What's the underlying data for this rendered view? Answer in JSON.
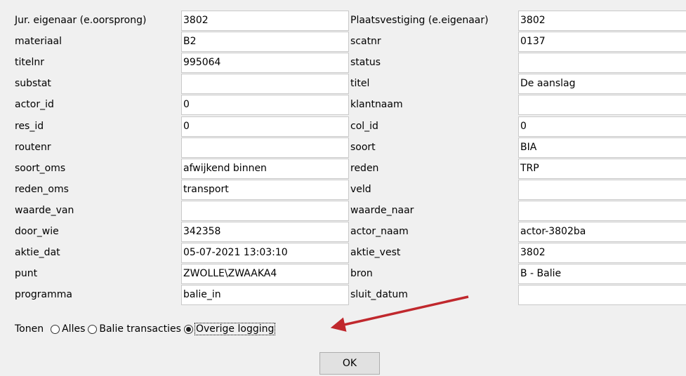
{
  "rows": [
    {
      "left_label": "Jur. eigenaar (e.oorsprong)",
      "left_value": "3802",
      "right_label": "Plaatsvestiging (e.eigenaar)",
      "right_value": "3802"
    },
    {
      "left_label": "materiaal",
      "left_value": "B2",
      "right_label": "scatnr",
      "right_value": "0137"
    },
    {
      "left_label": "titelnr",
      "left_value": "995064",
      "right_label": "status",
      "right_value": ""
    },
    {
      "left_label": "substat",
      "left_value": "",
      "right_label": "titel",
      "right_value": "De aanslag"
    },
    {
      "left_label": "actor_id",
      "left_value": "0",
      "right_label": "klantnaam",
      "right_value": ""
    },
    {
      "left_label": "res_id",
      "left_value": "0",
      "right_label": "col_id",
      "right_value": "0"
    },
    {
      "left_label": "routenr",
      "left_value": "",
      "right_label": "soort",
      "right_value": "BIA"
    },
    {
      "left_label": "soort_oms",
      "left_value": "afwijkend binnen",
      "right_label": "reden",
      "right_value": "TRP"
    },
    {
      "left_label": "reden_oms",
      "left_value": "transport",
      "right_label": "veld",
      "right_value": ""
    },
    {
      "left_label": "waarde_van",
      "left_value": "",
      "right_label": "waarde_naar",
      "right_value": ""
    },
    {
      "left_label": "door_wie",
      "left_value": "342358",
      "right_label": "actor_naam",
      "right_value": "actor-3802ba"
    },
    {
      "left_label": "aktie_dat",
      "left_value": "05-07-2021 13:03:10",
      "right_label": "aktie_vest",
      "right_value": "3802"
    },
    {
      "left_label": "punt",
      "left_value": "ZWOLLE\\ZWAAKA4",
      "right_label": "bron",
      "right_value": "B - Balie"
    },
    {
      "left_label": "programma",
      "left_value": "balie_in",
      "right_label": "sluit_datum",
      "right_value": ""
    }
  ],
  "tonen": {
    "label": "Tonen",
    "options": [
      {
        "label": "Alles",
        "selected": false
      },
      {
        "label": "Balie transacties",
        "selected": false
      },
      {
        "label": "Overige logging",
        "selected": true
      }
    ]
  },
  "ok_label": "OK",
  "annotation_color": "#c0282d"
}
